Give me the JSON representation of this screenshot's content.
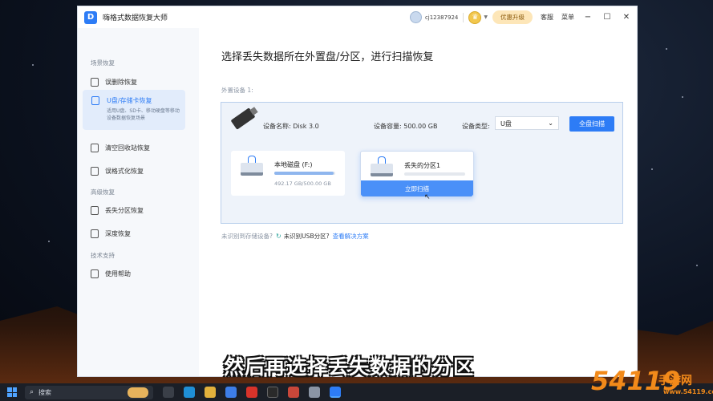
{
  "app": {
    "title": "嗨格式数据恢复大师",
    "logo_letter": "D",
    "username": "cj12387924",
    "upgrade_label": "优惠升级",
    "service_label": "客服",
    "menu_label": "菜单",
    "vip_icon": "crown-coin-icon"
  },
  "sidebar": {
    "section_scene": "场景恢复",
    "section_advanced": "高级恢复",
    "section_support": "技术支持",
    "items": [
      {
        "label": "误删除恢复",
        "icon": "file-icon"
      },
      {
        "label": "U盘/存储卡恢复",
        "icon": "usb-card-icon",
        "desc": "适用U盘、SD卡、移动硬盘等移动设备数据恢复场景",
        "active": true
      },
      {
        "label": "清空回收站恢复",
        "icon": "recycle-bin-icon"
      },
      {
        "label": "误格式化恢复",
        "icon": "format-icon"
      },
      {
        "label": "丢失分区恢复",
        "icon": "partition-icon"
      },
      {
        "label": "深度恢复",
        "icon": "deep-scan-icon"
      },
      {
        "label": "使用帮助",
        "icon": "help-icon"
      }
    ]
  },
  "main": {
    "heading": "选择丢失数据所在外置盘/分区，进行扫描恢复",
    "ext_label": "外置设备 1:",
    "device": {
      "name": "设备名称: Disk 3.0",
      "capacity": "设备容量: 500.00 GB",
      "type_label": "设备类型:",
      "type_value": "U盘",
      "scan_all": "全盘扫描"
    },
    "partitions": [
      {
        "name": "本地磁盘 (F:)",
        "size": "492.17 GB/500.00 GB",
        "used_fraction": 0.98
      },
      {
        "name": "丢失的分区1",
        "size": "",
        "used_fraction": 0.0,
        "action": "立即扫描"
      }
    ],
    "hint_prefix": "未识别到存储设备?",
    "hint_usb": "未识别USB分区?",
    "hint_link": "查看解决方案"
  },
  "subtitle": "然后再选择丢失数据的分区",
  "taskbar": {
    "search_placeholder": "搜索"
  },
  "watermark": {
    "num": "54119",
    "cn": "手游网",
    "url": "www.54119.com"
  },
  "colors": {
    "accent": "#2d7cf6",
    "upgrade_bg": "#fde6b8",
    "watermark": "#f28a1a"
  }
}
